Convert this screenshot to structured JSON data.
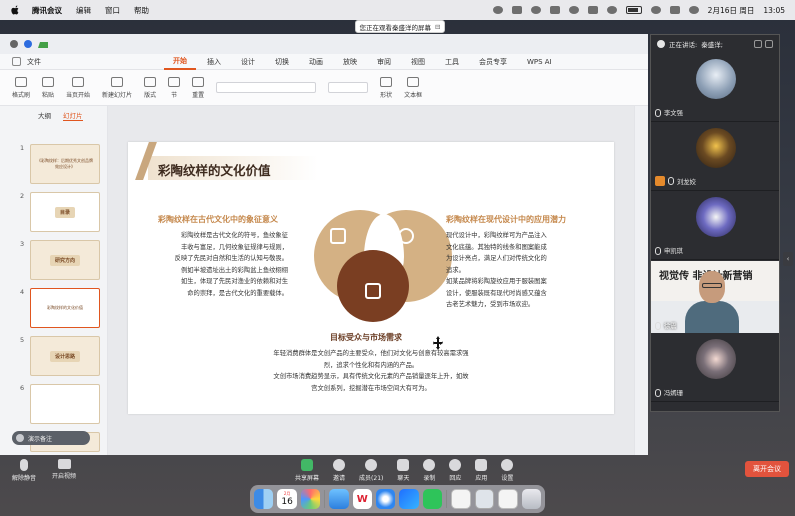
{
  "menubar": {
    "app_name": "腾讯会议",
    "items": [
      "编辑",
      "窗口",
      "帮助"
    ],
    "date": "2月16日 周日",
    "time": "13:05"
  },
  "banner": {
    "text": "您正在观看秦盛洋的屏幕",
    "icon": "⊟"
  },
  "wps": {
    "file_label": "文件",
    "tabs": [
      "开始",
      "插入",
      "设计",
      "切换",
      "动画",
      "放映",
      "审阅",
      "视图",
      "工具",
      "会员专享",
      "WPS AI"
    ],
    "active_tab": "开始",
    "tools": [
      "格式刷",
      "粘贴",
      "当页开始",
      "新建幻灯片",
      "版式",
      "节",
      "重置",
      "形状",
      "文本框"
    ],
    "side_tabs": [
      "大纲",
      "幻灯片"
    ],
    "notes_placeholder": "演示备注"
  },
  "thumbnails": [
    {
      "num": "1",
      "title": "《彩陶纹样：后期优秀文创品牌效应设计》"
    },
    {
      "num": "2",
      "title": "目录"
    },
    {
      "num": "3",
      "title": "研究方向"
    },
    {
      "num": "4",
      "title": "彩陶纹样的文化价值"
    },
    {
      "num": "5",
      "title": "设计思路"
    },
    {
      "num": "6",
      "title": ""
    },
    {
      "num": "7",
      "title": ""
    }
  ],
  "slide": {
    "title": "彩陶纹样的文化价值",
    "left_heading": "彩陶纹样在古代文化中的象征意义",
    "left_lines": [
      "彩陶纹样是古代文化的符号，鱼纹象征",
      "丰收与富足，几何纹象征规律与规则，",
      "反映了先民对自然和生活的认知与敬畏。",
      "例如半坡遗址出土的彩陶盆上鱼纹栩栩",
      "如生，体现了先民对渔业的依赖和对生",
      "命的崇拜，是古代文化的重要载体。"
    ],
    "right_heading": "彩陶纹样在现代设计中的应用潜力",
    "right_lines": [
      "现代设计中，彩陶纹样可为产品注入",
      "文化底蕴。其独特的线条和图案能成",
      "为设计亮点，满足人们对传统文化的",
      "追求。",
      "如某品牌将彩陶旋纹应用于服装图案",
      "设计，使服装既有现代时尚感又蕴含",
      "古老艺术魅力，受到市场欢迎。"
    ],
    "bottom_heading": "目标受众与市场需求",
    "bottom_lines": [
      "年轻消费群体是文创产品的主要受众，他们对文化与创意有较高需求强",
      "烈，追求个性化和有内涵的产品。",
      "文创市场消费趋势显示，具有传统文化元素的产品销量逐年上升，如故",
      "宫文创系列，挖掘潜在市场空间大有可为。"
    ]
  },
  "panel": {
    "speaking_label": "正在讲话:",
    "speaking_name": "秦盛洋;",
    "participants": [
      {
        "name": "李文强"
      },
      {
        "name": "刘龙姣"
      },
      {
        "name": "申凯琪"
      },
      {
        "name": "徐震"
      },
      {
        "name": "冯嫣珊"
      }
    ],
    "video_overlay_text": "视觉传  非设计新营销"
  },
  "toolbar": {
    "left": [
      "解除静音",
      "开启视频"
    ],
    "center": [
      "共享屏幕",
      "邀请",
      "成员(21)",
      "聊天",
      "录制",
      "回应",
      "应用",
      "设置"
    ],
    "leave": "离开会议"
  },
  "dock": {
    "calendar_month": "2月",
    "calendar_day": "16",
    "wps_letter": "W"
  }
}
